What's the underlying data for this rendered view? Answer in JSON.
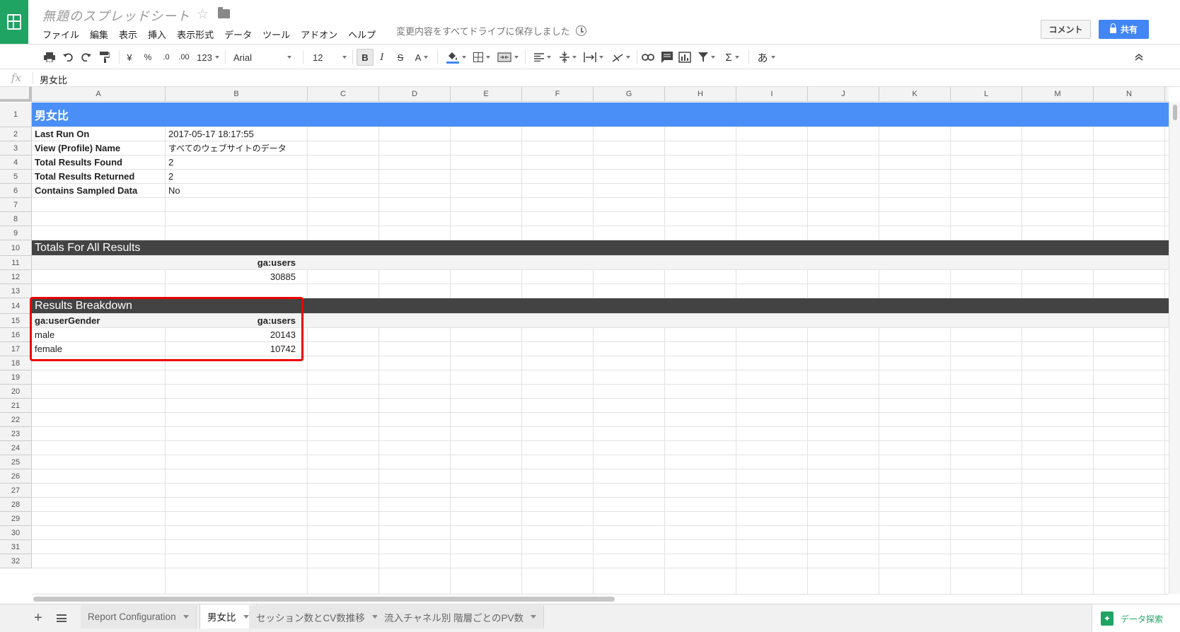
{
  "app": {
    "doc_title": "無題のスプレッドシート",
    "save_status": "変更内容をすべてドライブに保存しました",
    "comment_label": "コメント",
    "share_label": "共有"
  },
  "menu": [
    "ファイル",
    "編集",
    "表示",
    "挿入",
    "表示形式",
    "データ",
    "ツール",
    "アドオン",
    "ヘルプ"
  ],
  "toolbar": {
    "currency": "¥",
    "percent": "%",
    "dec_decrease": ".0",
    "dec_increase": ".00",
    "number_format": "123",
    "font": "Arial",
    "font_size": "12",
    "bold": "B",
    "italic": "I",
    "strike": "S",
    "text_color": "A",
    "sum": "Σ",
    "input_tool": "あ"
  },
  "formula_bar": {
    "fx": "fx",
    "content": "男女比"
  },
  "columns": [
    "A",
    "B",
    "C",
    "D",
    "E",
    "F",
    "G",
    "H",
    "I",
    "J",
    "K",
    "L",
    "M",
    "N"
  ],
  "rows": [
    "1",
    "2",
    "3",
    "4",
    "5",
    "6",
    "7",
    "8",
    "9",
    "10",
    "11",
    "12",
    "13",
    "14",
    "15",
    "16",
    "17",
    "18",
    "19",
    "20",
    "21",
    "22",
    "23",
    "24",
    "25",
    "26",
    "27",
    "28",
    "29",
    "30",
    "31",
    "32"
  ],
  "sheet": {
    "title": "男女比",
    "meta": [
      {
        "label": "Last Run On",
        "value": "2017-05-17 18:17:55"
      },
      {
        "label": "View (Profile) Name",
        "value": "すべてのウェブサイトのデータ"
      },
      {
        "label": "Total Results Found",
        "value": "2"
      },
      {
        "label": "Total Results Returned",
        "value": "2"
      },
      {
        "label": "Contains Sampled Data",
        "value": "No"
      }
    ],
    "totals_title": "Totals For All Results",
    "totals_header": "ga:users",
    "totals_value": "30885",
    "breakdown_title": "Results Breakdown",
    "breakdown_headers": [
      "ga:userGender",
      "ga:users"
    ],
    "breakdown_rows": [
      {
        "gender": "male",
        "users": "20143"
      },
      {
        "gender": "female",
        "users": "10742"
      }
    ]
  },
  "tabs": [
    "Report Configuration",
    "男女比",
    "セッション数とCV数推移",
    "流入チャネル別 階層ごとのPV数"
  ],
  "explore_label": "データ探索",
  "colors": {
    "title_band": "#4a8ff7",
    "section_band": "#434343",
    "highlight": "#ee0000",
    "brand_green": "#1fa463"
  }
}
